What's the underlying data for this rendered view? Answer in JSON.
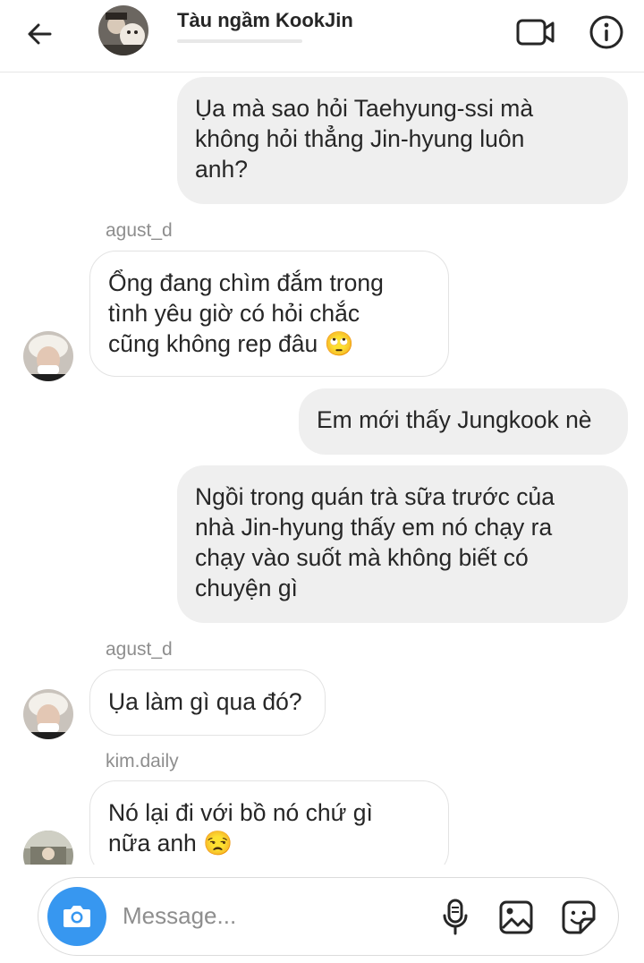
{
  "header": {
    "title": "Tàu ngầm KookJin",
    "back_icon": "arrow-left-icon",
    "video_icon": "video-camera-icon",
    "info_icon": "info-icon"
  },
  "messages": [
    {
      "from": "me",
      "text": "Ụa mà sao hỏi Taehyung-ssi mà\nkhông hỏi thẳng Jin-hyung luôn\nanh?"
    },
    {
      "from": "agust_d",
      "sender": "agust_d",
      "text": "Ổng đang chìm đắm trong\ntình yêu giờ có hỏi chắc\ncũng không rep đâu 🙄"
    },
    {
      "from": "me",
      "text": "Em mới thấy Jungkook nè"
    },
    {
      "from": "me",
      "text": "Ngồi trong quán trà sữa trước của\nnhà Jin-hyung thấy em nó chạy ra\nchạy vào suốt mà không biết có\nchuyện gì"
    },
    {
      "from": "agust_d",
      "sender": "agust_d",
      "text": "Ụa làm gì qua đó?"
    },
    {
      "from": "kim.daily",
      "sender": "kim.daily",
      "text": "Nó lại đi với bồ nó chứ gì\nnữa anh 😒"
    }
  ],
  "composer": {
    "placeholder": "Message...",
    "camera_icon": "camera-icon",
    "mic_icon": "microphone-icon",
    "image_icon": "image-icon",
    "sticker_icon": "sticker-icon",
    "accent_color": "#3797f0"
  }
}
